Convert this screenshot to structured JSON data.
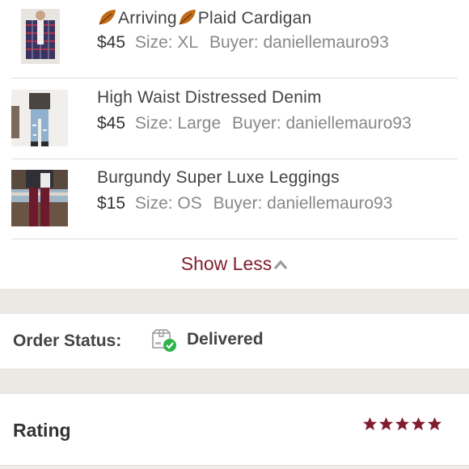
{
  "items": [
    {
      "title_prefix": "",
      "title_mid": "Arriving",
      "title_suffix": "Plaid Cardigan",
      "has_leaves": true,
      "price": "$45",
      "size": "Size: XL",
      "buyer": "Buyer: daniellemauro93"
    },
    {
      "title": "High Waist Distressed Denim",
      "price": "$45",
      "size": "Size: Large",
      "buyer": "Buyer: daniellemauro93"
    },
    {
      "title": "Burgundy Super Luxe Leggings",
      "price": "$15",
      "size": "Size: OS",
      "buyer": "Buyer: daniellemauro93"
    }
  ],
  "show_less": "Show Less",
  "order_status": {
    "label": "Order Status:",
    "value": "Delivered",
    "icon": "package-delivered-icon"
  },
  "rating": {
    "label": "Rating",
    "stars": 5,
    "max_stars": 5,
    "star_color": "#7f1d2c"
  },
  "colors": {
    "accent": "#7f1d2c",
    "success": "#2db34a",
    "background": "#efedea"
  }
}
